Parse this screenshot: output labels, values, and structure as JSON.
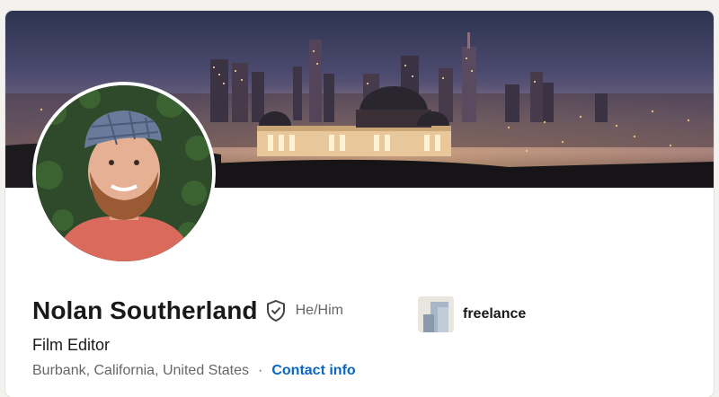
{
  "profile": {
    "name": "Nolan Southerland",
    "pronouns": "He/Him",
    "headline": "Film Editor",
    "location": "Burbank, California, United States",
    "separator": "·",
    "contact_link": "Contact info"
  },
  "company": {
    "name": "freelance",
    "logo_icon": "building-icon"
  },
  "icons": {
    "verified": "shield-check-icon"
  },
  "colors": {
    "link": "#0a66c2",
    "text_primary": "#191919",
    "text_secondary": "#666666",
    "background": "#f4f2ee"
  }
}
